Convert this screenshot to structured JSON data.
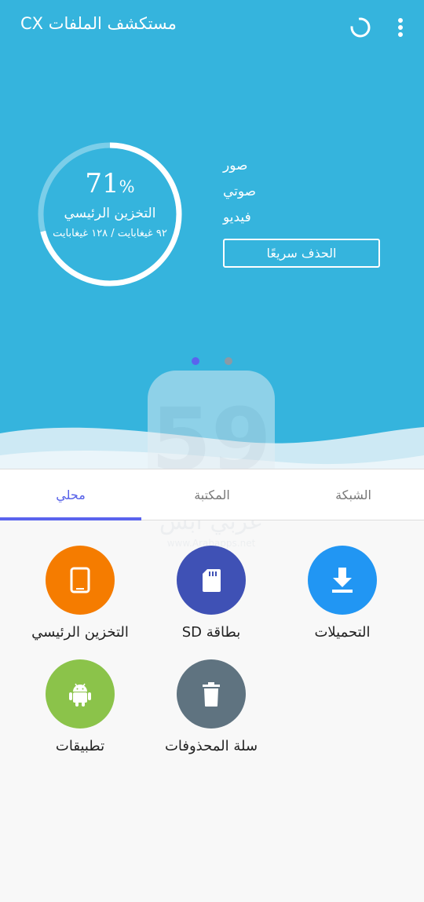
{
  "header": {
    "title": "مستكشف الملفات CX"
  },
  "storage": {
    "percent": "71",
    "percent_sign": "%",
    "label": "التخزين الرئيسي",
    "usage": "٩٢ غيغابايت / ١٢٨ غيغابايت",
    "used_fraction": 0.71
  },
  "categories": [
    "صور",
    "صوتي",
    "فيديو"
  ],
  "quick_clean_label": "الحذف سريعًا",
  "pager": {
    "page_count": 2,
    "active_page": 1
  },
  "tabs": [
    {
      "label": "الشبكة"
    },
    {
      "label": "المكتبة"
    },
    {
      "label": "محلي"
    }
  ],
  "active_tab": "محلي",
  "grid": [
    {
      "label": "التحميلات",
      "icon": "download-icon",
      "color": "#2196f3"
    },
    {
      "label": "بطاقة SD",
      "icon": "sd-card-icon",
      "color": "#3f51b5"
    },
    {
      "label": "التخزين الرئيسي",
      "icon": "tablet-icon",
      "color": "#f57c00"
    },
    {
      "label": "سلة المحذوفات",
      "icon": "trash-icon",
      "color": "#5f7380"
    },
    {
      "label": "تطبيقات",
      "icon": "android-icon",
      "color": "#8bc34a"
    }
  ],
  "watermark": {
    "text": "عربي ابس",
    "url": "www.Arabapps.net"
  },
  "colors": {
    "hero_bg": "#35b4dd",
    "accent": "#5a63ee",
    "page_bg": "#f8f8f8"
  }
}
